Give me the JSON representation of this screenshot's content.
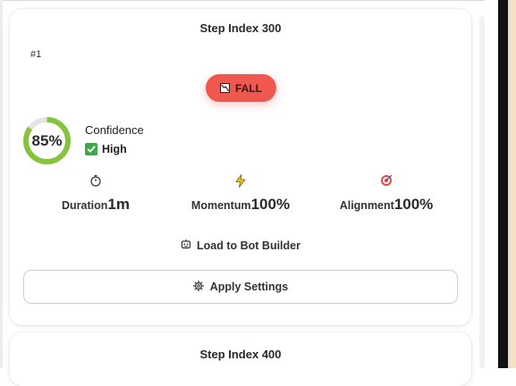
{
  "cards": [
    {
      "title": "Step Index 300",
      "rank": "#1",
      "signal": {
        "label": "FALL",
        "icon": "chart-down-icon",
        "color": "#f0584f"
      },
      "confidence": {
        "percent_text": "85%",
        "percent": 85,
        "label": "Confidence",
        "level": "High",
        "level_icon": "checkmark-icon",
        "ring_color": "#86c440",
        "track_color": "#e5e5e5"
      },
      "metrics": [
        {
          "icon": "stopwatch-icon",
          "label": "Duration",
          "value": "1m"
        },
        {
          "icon": "lightning-icon",
          "label": "Momentum",
          "value": "100%"
        },
        {
          "icon": "target-icon",
          "label": "Alignment",
          "value": "100%"
        }
      ],
      "load_button": {
        "icon": "robot-icon",
        "label": "Load to Bot Builder"
      },
      "apply_button": {
        "icon": "gear-icon",
        "label": "Apply Settings"
      }
    },
    {
      "title": "Step Index 400"
    }
  ]
}
